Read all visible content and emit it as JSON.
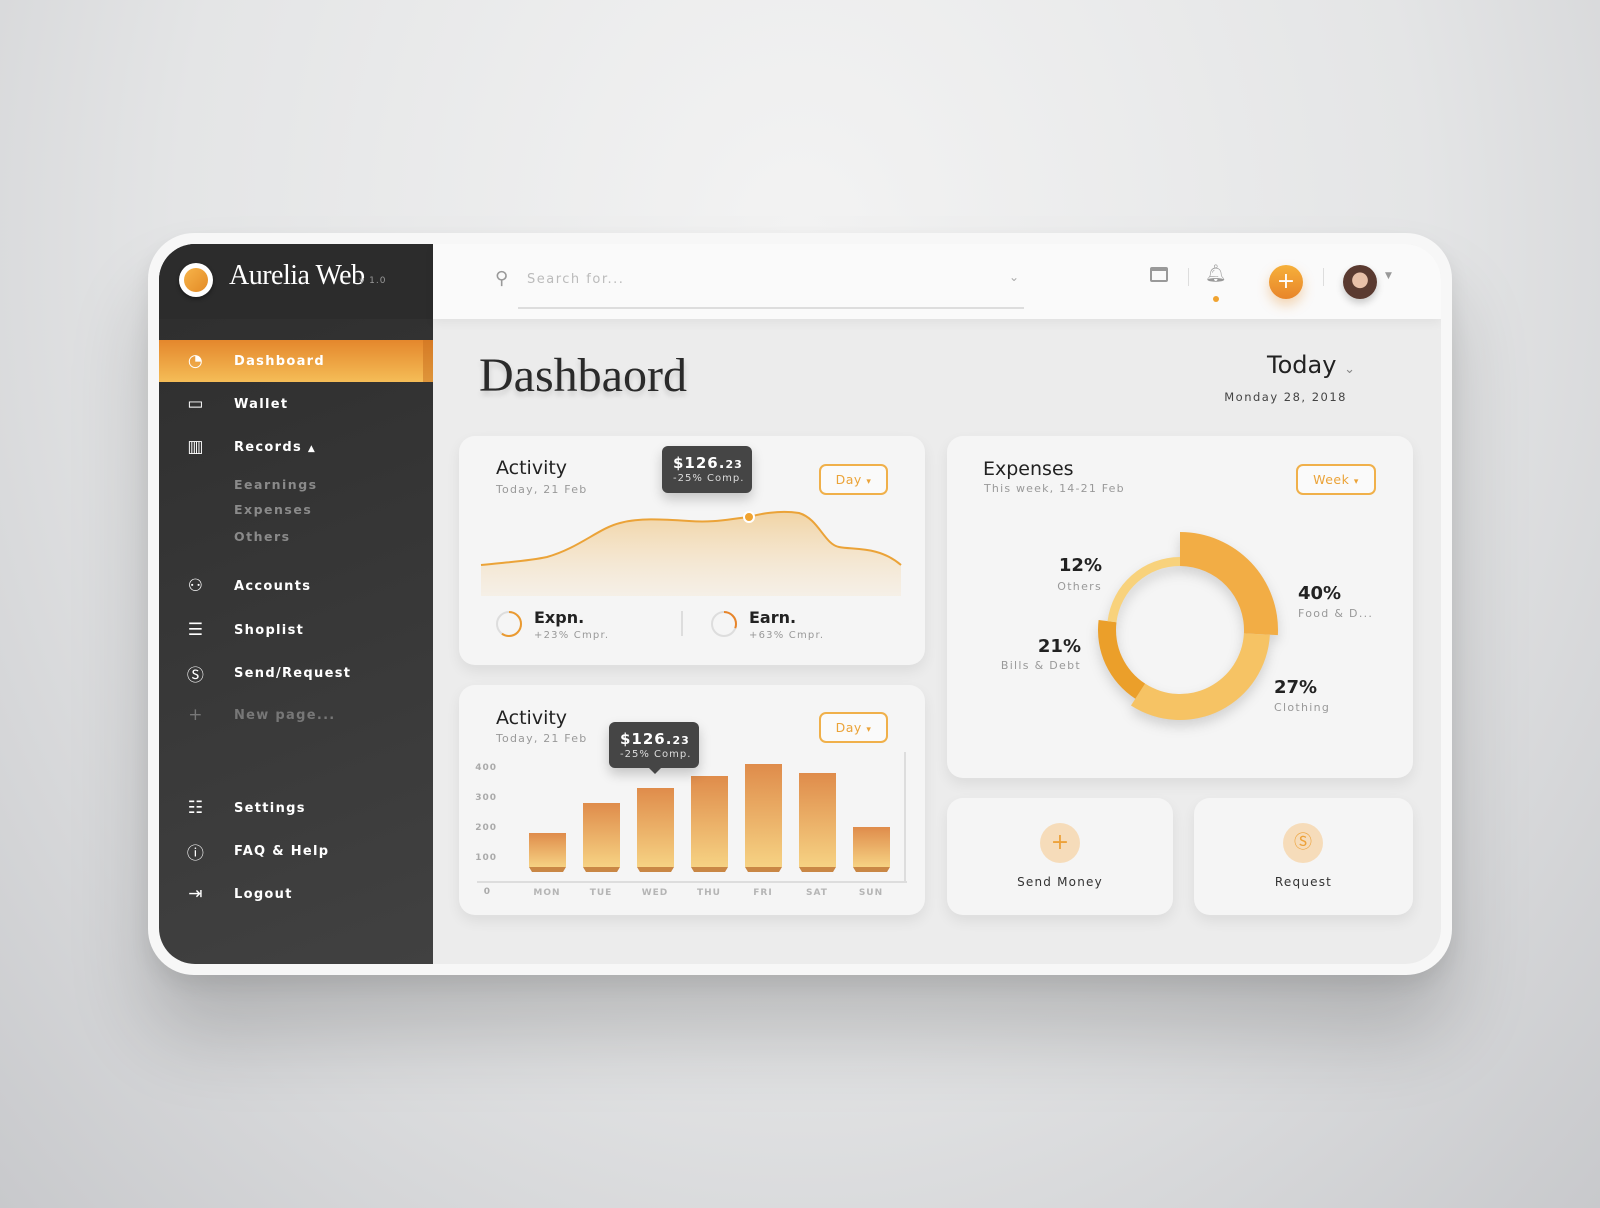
{
  "app": {
    "name": "Aurelia Web",
    "version": "v 1.0"
  },
  "sidebar": {
    "items": [
      {
        "label": "Dashboard",
        "icon": "gauge-icon",
        "active": true
      },
      {
        "label": "Wallet",
        "icon": "wallet-icon"
      },
      {
        "label": "Records",
        "icon": "records-icon",
        "caret": "▲"
      },
      {
        "label": "Accounts",
        "icon": "users-icon"
      },
      {
        "label": "Shoplist",
        "icon": "list-icon"
      },
      {
        "label": "Send/Request",
        "icon": "dollar-circle-icon"
      },
      {
        "label": "New page...",
        "icon": "plus-icon"
      },
      {
        "label": "Settings",
        "icon": "sliders-icon"
      },
      {
        "label": "FAQ & Help",
        "icon": "info-icon"
      },
      {
        "label": "Logout",
        "icon": "logout-icon"
      }
    ],
    "records_sub": [
      "Eearnings",
      "Expenses",
      "Others"
    ]
  },
  "topbar": {
    "search_placeholder": "Search for...",
    "accent": "#f0a330"
  },
  "page": {
    "title": "Dashbaord",
    "period": "Today",
    "date": "Monday 28, 2018"
  },
  "activity_line": {
    "title": "Activity",
    "subtitle": "Today, 21 Feb",
    "dropdown": "Day",
    "tooltip_main": "$126.",
    "tooltip_cents": "23",
    "tooltip_sub": "-25% Comp.",
    "legend": [
      {
        "label": "Expn.",
        "sub": "+23% Cmpr.",
        "progress": 0.6
      },
      {
        "label": "Earn.",
        "sub": "+63% Cmpr.",
        "progress": 0.3
      }
    ]
  },
  "activity_bar": {
    "title": "Activity",
    "subtitle": "Today, 21 Feb",
    "dropdown": "Day",
    "tooltip_main": "$126.",
    "tooltip_cents": "23",
    "tooltip_sub": "-25% Comp."
  },
  "chart_data": [
    {
      "type": "bar",
      "categories": [
        "MON",
        "TUE",
        "WED",
        "THU",
        "FRI",
        "SAT",
        "SUN"
      ],
      "values": [
        180,
        280,
        330,
        370,
        410,
        380,
        200
      ],
      "yticks": [
        "0",
        "100",
        "200",
        "300",
        "400"
      ],
      "ylim": [
        0,
        400
      ],
      "highlight": "WED"
    },
    {
      "type": "pie",
      "title": "Expenses",
      "subtitle": "This week, 14-21 Feb",
      "dropdown": "Week",
      "slices": [
        {
          "label": "Food & D...",
          "value": 40,
          "text": "40%"
        },
        {
          "label": "Clothing",
          "value": 27,
          "text": "27%"
        },
        {
          "label": "Bills & Debt",
          "value": 21,
          "text": "21%"
        },
        {
          "label": "Others",
          "value": 12,
          "text": "12%"
        }
      ]
    }
  ],
  "actions": [
    {
      "label": "Send Money",
      "icon": "plus-icon"
    },
    {
      "label": "Request",
      "icon": "dollar-circle-icon"
    }
  ]
}
